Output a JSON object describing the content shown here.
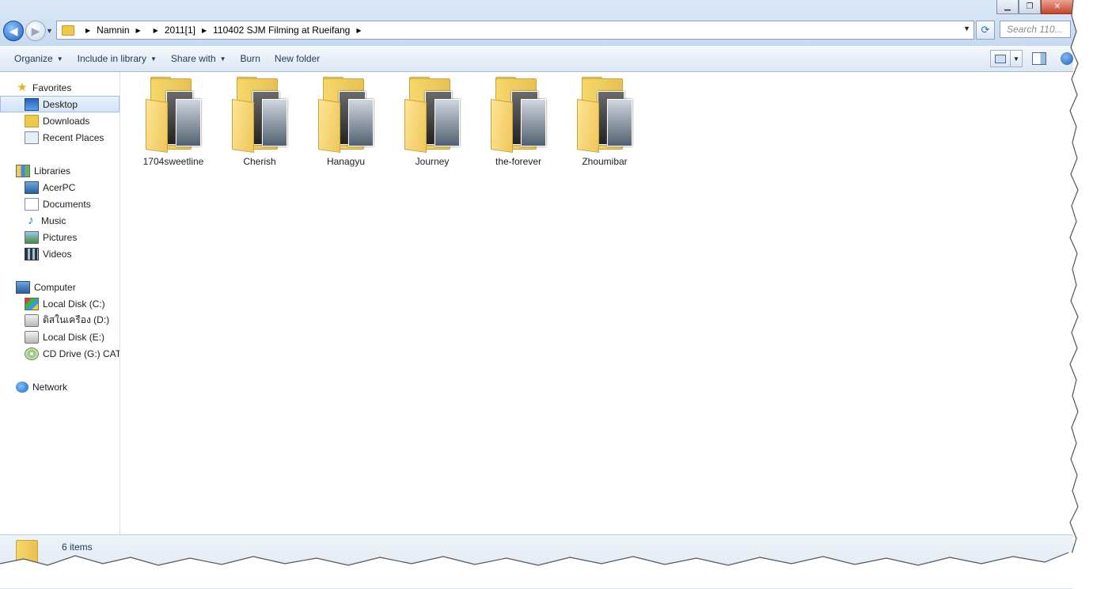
{
  "window": {
    "caption": {
      "minimize": "▁",
      "maximize": "❐",
      "close": "✕"
    }
  },
  "address": {
    "crumbs": [
      "Namnin",
      "",
      "2011[1]",
      "110402 SJM Filming at Rueifang"
    ],
    "search_placeholder": "Search 110..."
  },
  "toolbar": {
    "items": [
      {
        "label": "Organize",
        "dropdown": true
      },
      {
        "label": "Include in library",
        "dropdown": true
      },
      {
        "label": "Share with",
        "dropdown": true
      },
      {
        "label": "Burn",
        "dropdown": false
      },
      {
        "label": "New folder",
        "dropdown": false
      }
    ]
  },
  "nav": {
    "favorites": {
      "label": "Favorites",
      "items": [
        "Desktop",
        "Downloads",
        "Recent Places"
      ]
    },
    "libraries": {
      "label": "Libraries",
      "items": [
        "AcerPC",
        "Documents",
        "Music",
        "Pictures",
        "Videos"
      ]
    },
    "computer": {
      "label": "Computer",
      "items": [
        "Local Disk (C:)",
        "ดิสในเครือง (D:)",
        "Local Disk (E:)",
        "CD Drive (G:) CAT C"
      ]
    },
    "network": {
      "label": "Network"
    }
  },
  "folders": [
    {
      "name": "1704sweetline"
    },
    {
      "name": "Cherish"
    },
    {
      "name": "Hanagyu"
    },
    {
      "name": "Journey"
    },
    {
      "name": "the-forever"
    },
    {
      "name": "Zhoumibar"
    }
  ],
  "status": {
    "count": "6 items"
  },
  "colors": {
    "accent": "#1e395b",
    "selection": "#d2e3f7",
    "folder": "#f6d86c"
  }
}
